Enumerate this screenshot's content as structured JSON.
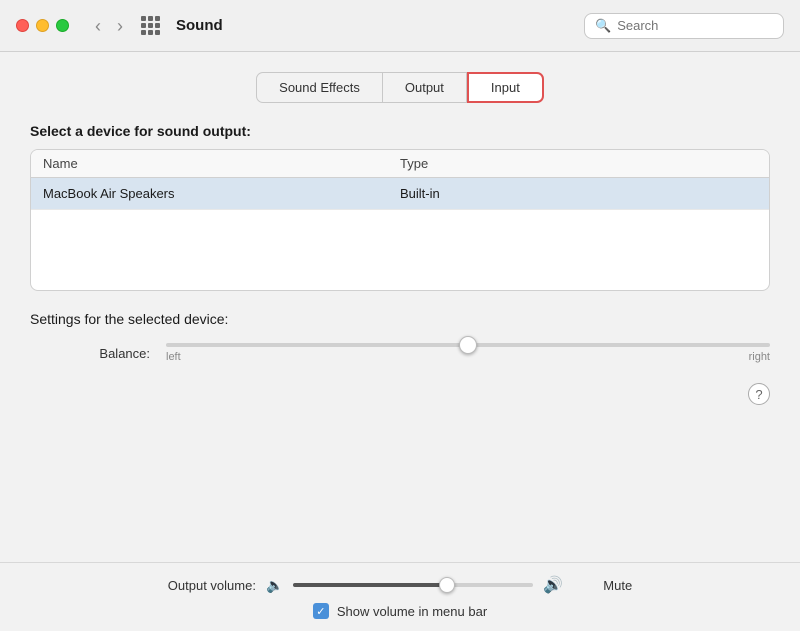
{
  "titleBar": {
    "title": "Sound",
    "searchPlaceholder": "Search"
  },
  "tabs": [
    {
      "id": "sound-effects",
      "label": "Sound Effects",
      "active": false
    },
    {
      "id": "output",
      "label": "Output",
      "active": false
    },
    {
      "id": "input",
      "label": "Input",
      "active": true
    }
  ],
  "panel": {
    "deviceSectionTitle": "Select a device for sound output:",
    "tableHeaders": {
      "name": "Name",
      "type": "Type"
    },
    "devices": [
      {
        "name": "MacBook Air Speakers",
        "type": "Built-in"
      }
    ],
    "settingsSectionTitle": "Settings for the selected device:",
    "balance": {
      "label": "Balance:",
      "leftLabel": "left",
      "rightLabel": "right",
      "value": 50
    }
  },
  "bottomBar": {
    "volumeLabel": "Output volume:",
    "volumeValue": 65,
    "muteLabel": "Mute",
    "showVolumeLabel": "Show volume in menu bar",
    "showVolumeChecked": true
  },
  "helpLabel": "?"
}
